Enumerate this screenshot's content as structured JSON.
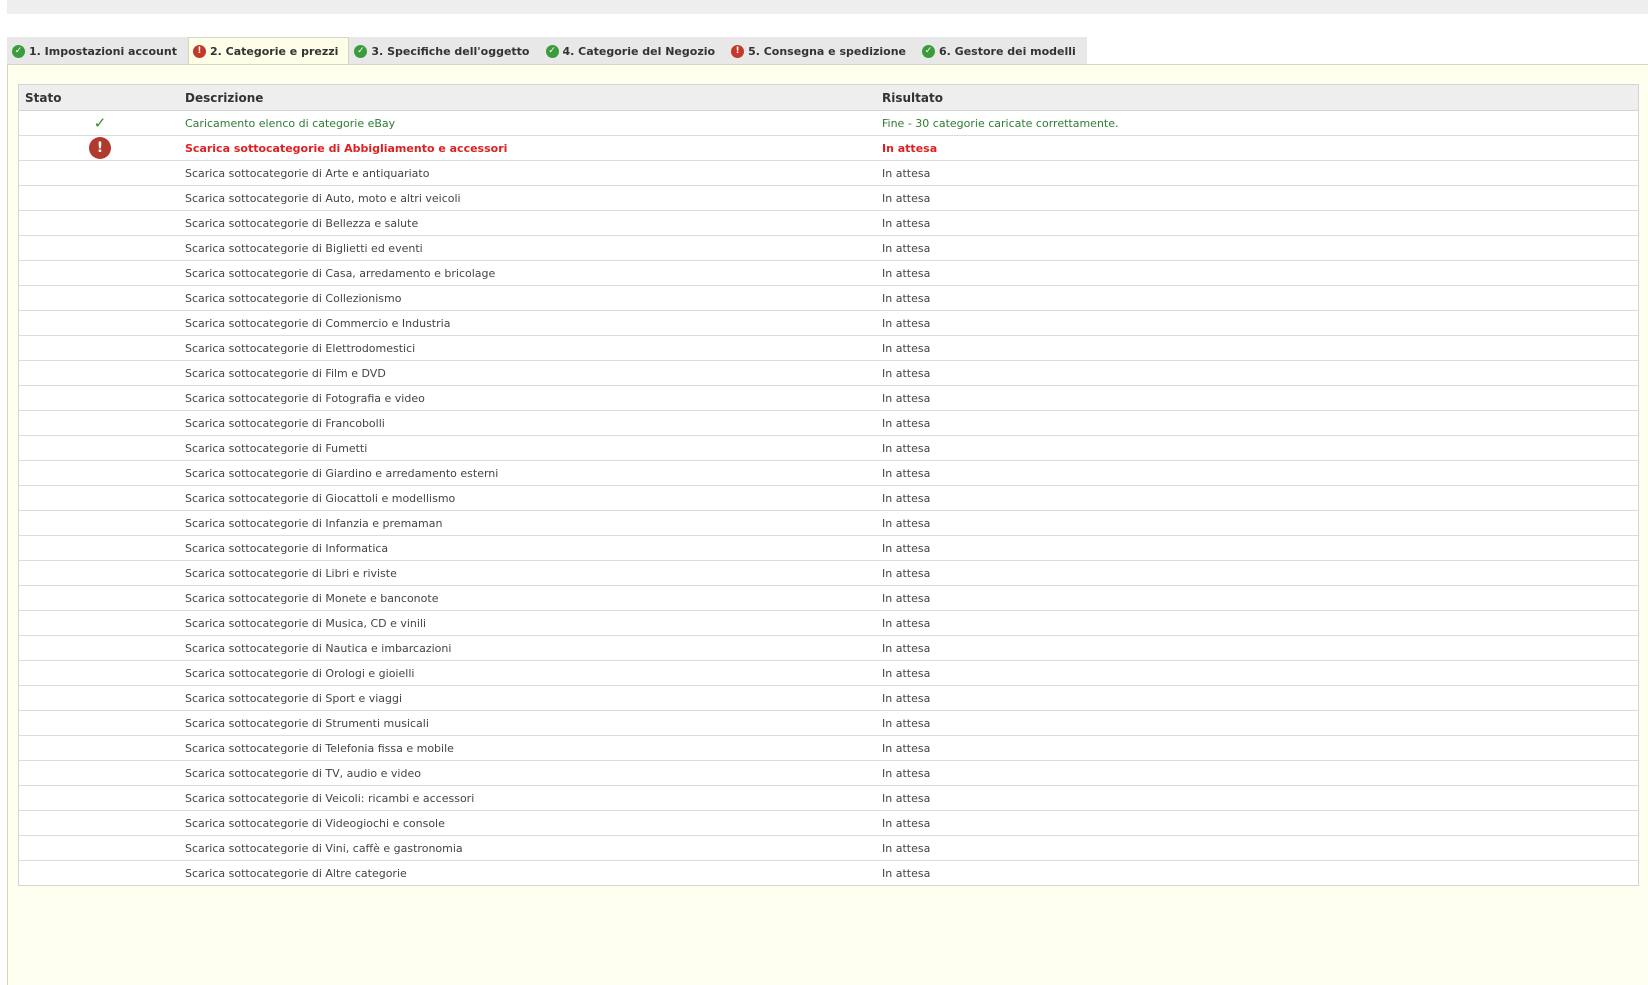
{
  "tabs": [
    {
      "label": "1. Impostazioni account",
      "status": "ok",
      "active": false
    },
    {
      "label": "2. Categorie e prezzi",
      "status": "error",
      "active": true
    },
    {
      "label": "3. Specifiche dell'oggetto",
      "status": "ok",
      "active": false
    },
    {
      "label": "4. Categorie del Negozio",
      "status": "ok",
      "active": false
    },
    {
      "label": "5. Consegna e spedizione",
      "status": "error",
      "active": false
    },
    {
      "label": "6. Gestore dei modelli",
      "status": "ok",
      "active": false
    }
  ],
  "table": {
    "headers": {
      "stato": "Stato",
      "descrizione": "Descrizione",
      "risultato": "Risultato"
    },
    "rows": [
      {
        "status": "ok",
        "descrizione": "Caricamento elenco di categorie eBay",
        "risultato": "Fine - 30 categorie caricate correttamente."
      },
      {
        "status": "error",
        "descrizione": "Scarica sottocategorie di Abbigliamento e accessori",
        "risultato": "In attesa"
      },
      {
        "status": "none",
        "descrizione": "Scarica sottocategorie di Arte e antiquariato",
        "risultato": "In attesa"
      },
      {
        "status": "none",
        "descrizione": "Scarica sottocategorie di Auto, moto e altri veicoli",
        "risultato": "In attesa"
      },
      {
        "status": "none",
        "descrizione": "Scarica sottocategorie di Bellezza e salute",
        "risultato": "In attesa"
      },
      {
        "status": "none",
        "descrizione": "Scarica sottocategorie di Biglietti ed eventi",
        "risultato": "In attesa"
      },
      {
        "status": "none",
        "descrizione": "Scarica sottocategorie di Casa, arredamento e bricolage",
        "risultato": "In attesa"
      },
      {
        "status": "none",
        "descrizione": "Scarica sottocategorie di Collezionismo",
        "risultato": "In attesa"
      },
      {
        "status": "none",
        "descrizione": "Scarica sottocategorie di Commercio e Industria",
        "risultato": "In attesa"
      },
      {
        "status": "none",
        "descrizione": "Scarica sottocategorie di Elettrodomestici",
        "risultato": "In attesa"
      },
      {
        "status": "none",
        "descrizione": "Scarica sottocategorie di Film e DVD",
        "risultato": "In attesa"
      },
      {
        "status": "none",
        "descrizione": "Scarica sottocategorie di Fotografia e video",
        "risultato": "In attesa"
      },
      {
        "status": "none",
        "descrizione": "Scarica sottocategorie di Francobolli",
        "risultato": "In attesa"
      },
      {
        "status": "none",
        "descrizione": "Scarica sottocategorie di Fumetti",
        "risultato": "In attesa"
      },
      {
        "status": "none",
        "descrizione": "Scarica sottocategorie di Giardino e arredamento esterni",
        "risultato": "In attesa"
      },
      {
        "status": "none",
        "descrizione": "Scarica sottocategorie di Giocattoli e modellismo",
        "risultato": "In attesa"
      },
      {
        "status": "none",
        "descrizione": "Scarica sottocategorie di Infanzia e premaman",
        "risultato": "In attesa"
      },
      {
        "status": "none",
        "descrizione": "Scarica sottocategorie di Informatica",
        "risultato": "In attesa"
      },
      {
        "status": "none",
        "descrizione": "Scarica sottocategorie di Libri e riviste",
        "risultato": "In attesa"
      },
      {
        "status": "none",
        "descrizione": "Scarica sottocategorie di Monete e banconote",
        "risultato": "In attesa"
      },
      {
        "status": "none",
        "descrizione": "Scarica sottocategorie di Musica, CD e vinili",
        "risultato": "In attesa"
      },
      {
        "status": "none",
        "descrizione": "Scarica sottocategorie di Nautica e imbarcazioni",
        "risultato": "In attesa"
      },
      {
        "status": "none",
        "descrizione": "Scarica sottocategorie di Orologi e gioielli",
        "risultato": "In attesa"
      },
      {
        "status": "none",
        "descrizione": "Scarica sottocategorie di Sport e viaggi",
        "risultato": "In attesa"
      },
      {
        "status": "none",
        "descrizione": "Scarica sottocategorie di Strumenti musicali",
        "risultato": "In attesa"
      },
      {
        "status": "none",
        "descrizione": "Scarica sottocategorie di Telefonia fissa e mobile",
        "risultato": "In attesa"
      },
      {
        "status": "none",
        "descrizione": "Scarica sottocategorie di TV, audio e video",
        "risultato": "In attesa"
      },
      {
        "status": "none",
        "descrizione": "Scarica sottocategorie di Veicoli: ricambi e accessori",
        "risultato": "In attesa"
      },
      {
        "status": "none",
        "descrizione": "Scarica sottocategorie di Videogiochi e console",
        "risultato": "In attesa"
      },
      {
        "status": "none",
        "descrizione": "Scarica sottocategorie di Vini, caffè e gastronomia",
        "risultato": "In attesa"
      },
      {
        "status": "none",
        "descrizione": "Scarica sottocategorie di Altre categorie",
        "risultato": "In attesa"
      }
    ]
  },
  "icons": {
    "ok": "check-circle-icon",
    "error": "exclamation-circle-icon"
  },
  "colors": {
    "ok": "#3c9c3c",
    "error": "#c0392b",
    "panel": "#fffff0"
  }
}
